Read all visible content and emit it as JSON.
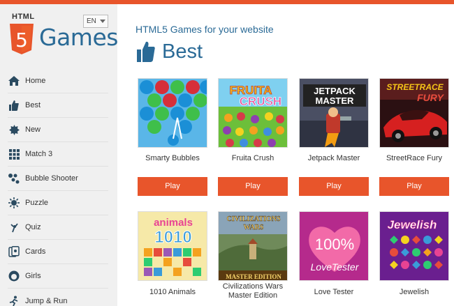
{
  "logo": {
    "html_label": "HTML",
    "shield_number": "5",
    "name": "Games"
  },
  "language": {
    "selected": "EN"
  },
  "nav": [
    {
      "label": "Home",
      "icon": "home-icon"
    },
    {
      "label": "Best",
      "icon": "thumbs-up-icon"
    },
    {
      "label": "New",
      "icon": "new-badge-icon"
    },
    {
      "label": "Match 3",
      "icon": "grid-icon"
    },
    {
      "label": "Bubble Shooter",
      "icon": "bubbles-icon"
    },
    {
      "label": "Puzzle",
      "icon": "puzzle-icon"
    },
    {
      "label": "Quiz",
      "icon": "quiz-icon"
    },
    {
      "label": "Cards",
      "icon": "cards-icon"
    },
    {
      "label": "Girls",
      "icon": "girl-icon"
    },
    {
      "label": "Jump & Run",
      "icon": "runner-icon"
    }
  ],
  "tagline": "HTML5 Games for your website",
  "section_title": "Best",
  "games_row1": [
    {
      "title": "Smarty Bubbles",
      "play": "Play"
    },
    {
      "title": "Fruita Crush",
      "play": "Play",
      "thumb_text": [
        "FRUITA",
        "CRUSH"
      ]
    },
    {
      "title": "Jetpack Master",
      "play": "Play",
      "thumb_text": [
        "JETPACK",
        "MASTER"
      ]
    },
    {
      "title": "StreetRace Fury",
      "play": "Play",
      "thumb_text": [
        "STREETRACE",
        "FURY"
      ]
    }
  ],
  "games_row2": [
    {
      "title": "1010 Animals",
      "thumb_text": [
        "animals",
        "1010"
      ]
    },
    {
      "title": "Civilizations Wars Master Edition",
      "title_lines": [
        "Civilizations Wars",
        "Master Edition"
      ],
      "thumb_text": [
        "CIVILIZATIONS",
        "WARS",
        "MASTER EDITION"
      ]
    },
    {
      "title": "Love Tester",
      "thumb_text": [
        "100%",
        "LoveTester"
      ]
    },
    {
      "title": "Jewelish",
      "thumb_text": [
        "Jewelish"
      ]
    }
  ],
  "colors": {
    "accent": "#e8552b",
    "brand_blue": "#2a6a96",
    "sidebar_bg": "#f0f0f0"
  }
}
